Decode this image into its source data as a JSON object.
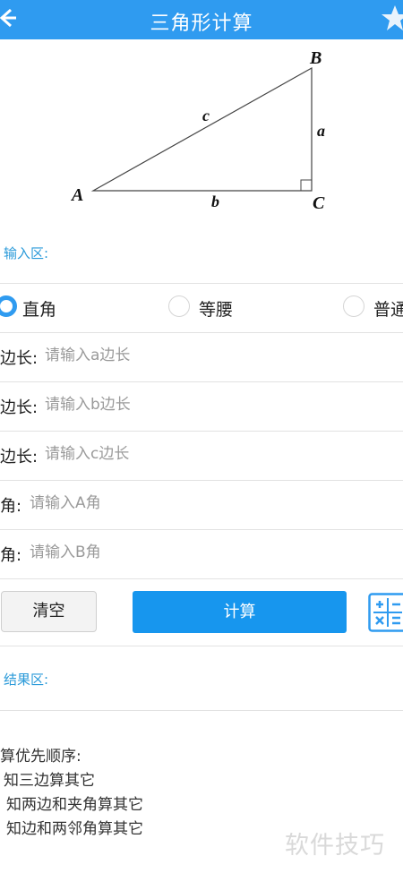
{
  "header": {
    "title": "三角形计算"
  },
  "diagram": {
    "vertex_a": "A",
    "vertex_b": "B",
    "vertex_c": "C",
    "side_a": "a",
    "side_b": "b",
    "side_c": "c"
  },
  "input_section": {
    "label": "输入区:"
  },
  "triangle_types": [
    {
      "label": "直角",
      "selected": true
    },
    {
      "label": "等腰",
      "selected": false
    },
    {
      "label": "普通",
      "selected": false
    }
  ],
  "fields": [
    {
      "label": "边长:",
      "placeholder": "请输入a边长"
    },
    {
      "label": "边长:",
      "placeholder": "请输入b边长"
    },
    {
      "label": "边长:",
      "placeholder": "请输入c边长"
    },
    {
      "label": "角:",
      "placeholder": "请输入A角"
    },
    {
      "label": "角:",
      "placeholder": "请输入B角"
    }
  ],
  "buttons": {
    "clear": "清空",
    "calculate": "计算"
  },
  "result_section": {
    "label": "结果区:"
  },
  "notes": [
    "算优先顺序:",
    "知三边算其它",
    "知两边和夹角算其它",
    "知边和两邻角算其它"
  ],
  "watermark": "软件技巧",
  "colors": {
    "header": "#2f9bf0",
    "accent": "#1796ee",
    "section_label": "#2a9ad9"
  }
}
